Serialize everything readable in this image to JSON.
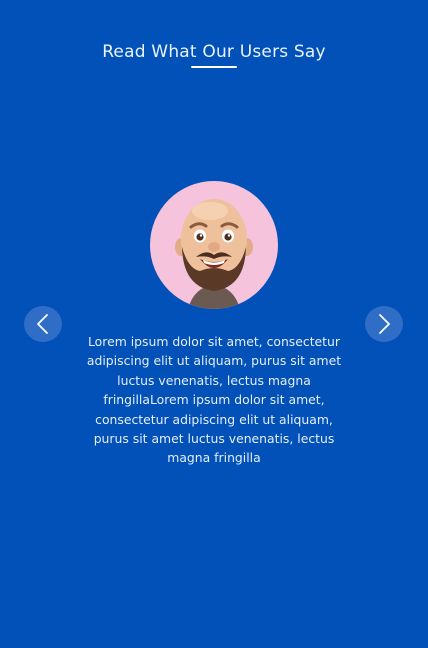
{
  "section": {
    "title": "Read What Our Users Say"
  },
  "testimonial": {
    "avatar_icon": "bald-bearded-man-avatar",
    "text": "Lorem ipsum dolor sit amet, consectetur adipiscing elit ut aliquam, purus sit amet luctus venenatis, lectus magna fringillaLorem ipsum dolor sit amet, consectetur adipiscing elit ut aliquam, purus sit amet luctus venenatis, lectus magna fringilla"
  },
  "controls": {
    "prev_icon": "chevron-left-icon",
    "next_icon": "chevron-right-icon"
  },
  "colors": {
    "background": "#0151b8",
    "nav_button": "#2f6dc6",
    "avatar_bg": "#f6c3dc",
    "text": "#e6eefc"
  }
}
